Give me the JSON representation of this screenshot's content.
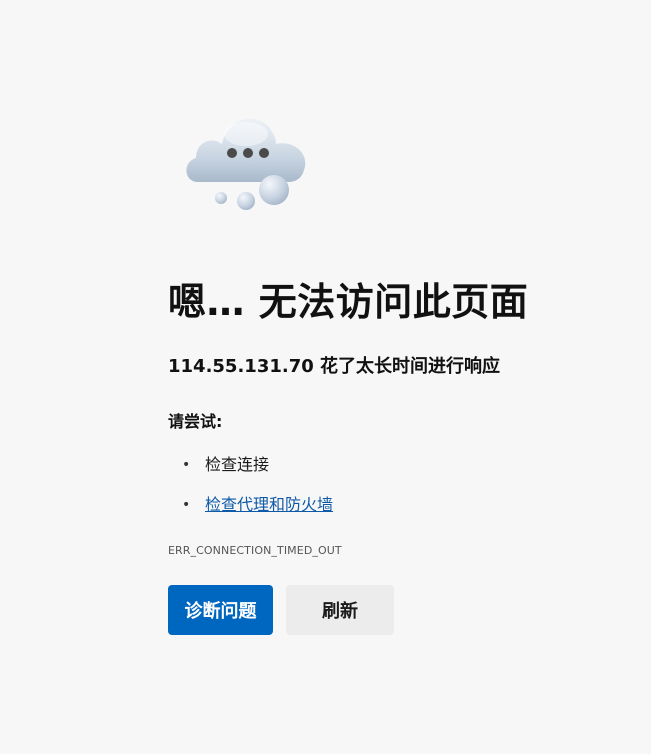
{
  "error": {
    "icon": "cloud-thinking-icon",
    "title": "嗯… 无法访问此页面",
    "message": "114.55.131.70 花了太长时间进行响应",
    "try_label": "请尝试:",
    "suggestions": [
      {
        "label": "检查连接",
        "is_link": false
      },
      {
        "label": "检查代理和防火墙",
        "is_link": true
      }
    ],
    "code": "ERR_CONNECTION_TIMED_OUT"
  },
  "actions": {
    "diagnose_label": "诊断问题",
    "refresh_label": "刷新"
  },
  "colors": {
    "background": "#f7f7f7",
    "primary_button": "#0067c0",
    "secondary_button": "#ececec",
    "link": "#0f5aa8"
  }
}
